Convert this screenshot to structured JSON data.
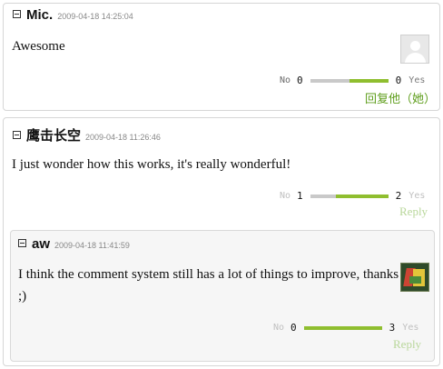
{
  "comments": [
    {
      "author": "Mic.",
      "date": "2009-04-18 14:25:04",
      "text": "Awesome",
      "avatar": "default-avatar-icon",
      "votes": {
        "no_label": "No",
        "no_count": "0",
        "yes_count": "0",
        "yes_label": "Yes",
        "yes_ratio": 0.5
      },
      "reply_label": "回复他（她）"
    },
    {
      "author": "鹰击长空",
      "date": "2009-04-18 11:26:46",
      "text": "I just wonder how this works, it's really wonderful!",
      "votes": {
        "no_label": "No",
        "no_count": "1",
        "yes_count": "2",
        "yes_label": "Yes",
        "yes_ratio": 0.67
      },
      "reply_label": "Reply",
      "children": [
        {
          "author": "aw",
          "date": "2009-04-18 11:41:59",
          "text": "I think the comment system still has a lot of things to improve, thanks ;)",
          "avatar": "custom-avatar-icon",
          "votes": {
            "no_label": "No",
            "no_count": "0",
            "yes_count": "3",
            "yes_label": "Yes",
            "yes_ratio": 1.0
          },
          "reply_label": "Reply"
        }
      ]
    }
  ],
  "colors": {
    "bar_yes": "#8fbe2f",
    "bar_no": "#c9c9c9",
    "reply_link": "#5f9e1d"
  }
}
